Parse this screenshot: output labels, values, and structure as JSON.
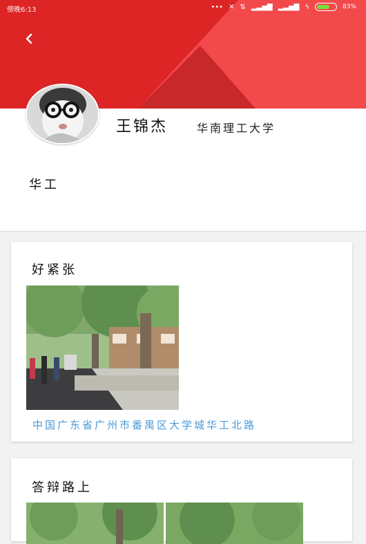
{
  "status_bar": {
    "left_text": "傍晚6:13",
    "battery_text": "83%"
  },
  "colors": {
    "header_red": "#e02a2b",
    "link_blue": "#4a9ad8"
  },
  "header": {
    "back_icon": "chevron-left-icon"
  },
  "profile": {
    "name": "王锦杰",
    "school": "华南理工大学",
    "bio": "华工"
  },
  "posts": [
    {
      "title": "好紧张",
      "location": "中国广东省广州市番禺区大学城华工北路"
    },
    {
      "title": "答辩路上"
    }
  ]
}
